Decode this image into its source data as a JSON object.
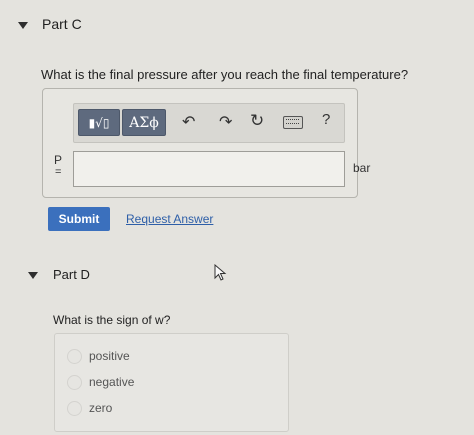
{
  "part_c": {
    "title": "Part C",
    "question": "What is the final pressure after you reach the final temperature?",
    "toolbar": {
      "template_symbol": "▮√▯",
      "greek_label": "ΑΣϕ",
      "help_label": "?"
    },
    "variable_label": "P",
    "equals": "=",
    "input_value": "",
    "unit": "bar",
    "submit_label": "Submit",
    "request_answer_label": "Request Answer"
  },
  "part_d": {
    "title": "Part D",
    "question": "What is the sign of w?",
    "choices": [
      {
        "label": "positive"
      },
      {
        "label": "negative"
      },
      {
        "label": "zero"
      }
    ]
  }
}
